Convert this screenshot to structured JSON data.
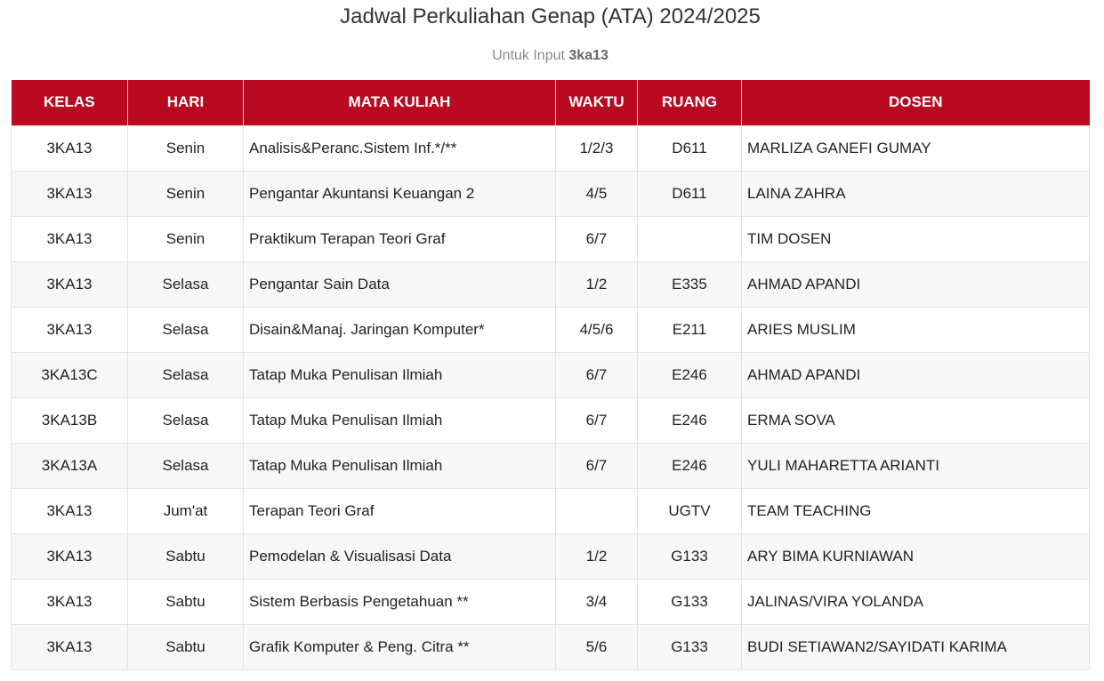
{
  "header": {
    "title": "Jadwal Perkuliahan Genap (ATA) 2024/2025",
    "subtitle_prefix": "Untuk Input",
    "subtitle_value": "3ka13"
  },
  "colors": {
    "header_bg": "#b90a22",
    "header_text": "#ffffff",
    "stripe": "#f7f7f7"
  },
  "table": {
    "columns": [
      "KELAS",
      "HARI",
      "MATA KULIAH",
      "WAKTU",
      "RUANG",
      "DOSEN"
    ],
    "rows": [
      {
        "kelas": "3KA13",
        "hari": "Senin",
        "mata_kuliah": "Analisis&Peranc.Sistem Inf.*/**",
        "waktu": "1/2/3",
        "ruang": "D611",
        "dosen": "MARLIZA GANEFI GUMAY"
      },
      {
        "kelas": "3KA13",
        "hari": "Senin",
        "mata_kuliah": "Pengantar Akuntansi Keuangan 2",
        "waktu": "4/5",
        "ruang": "D611",
        "dosen": "LAINA ZAHRA"
      },
      {
        "kelas": "3KA13",
        "hari": "Senin",
        "mata_kuliah": "Praktikum Terapan Teori Graf",
        "waktu": "6/7",
        "ruang": "",
        "dosen": "TIM DOSEN"
      },
      {
        "kelas": "3KA13",
        "hari": "Selasa",
        "mata_kuliah": "Pengantar Sain Data",
        "waktu": "1/2",
        "ruang": "E335",
        "dosen": "AHMAD APANDI"
      },
      {
        "kelas": "3KA13",
        "hari": "Selasa",
        "mata_kuliah": "Disain&Manaj. Jaringan Komputer*",
        "waktu": "4/5/6",
        "ruang": "E211",
        "dosen": "ARIES MUSLIM"
      },
      {
        "kelas": "3KA13C",
        "hari": "Selasa",
        "mata_kuliah": "Tatap Muka Penulisan Ilmiah",
        "waktu": "6/7",
        "ruang": "E246",
        "dosen": "AHMAD APANDI"
      },
      {
        "kelas": "3KA13B",
        "hari": "Selasa",
        "mata_kuliah": "Tatap Muka Penulisan Ilmiah",
        "waktu": "6/7",
        "ruang": "E246",
        "dosen": "ERMA SOVA"
      },
      {
        "kelas": "3KA13A",
        "hari": "Selasa",
        "mata_kuliah": "Tatap Muka Penulisan Ilmiah",
        "waktu": "6/7",
        "ruang": "E246",
        "dosen": "YULI MAHARETTA ARIANTI"
      },
      {
        "kelas": "3KA13",
        "hari": "Jum'at",
        "mata_kuliah": "Terapan Teori Graf",
        "waktu": "",
        "ruang": "UGTV",
        "dosen": "TEAM TEACHING"
      },
      {
        "kelas": "3KA13",
        "hari": "Sabtu",
        "mata_kuliah": "Pemodelan & Visualisasi Data",
        "waktu": "1/2",
        "ruang": "G133",
        "dosen": "ARY BIMA KURNIAWAN"
      },
      {
        "kelas": "3KA13",
        "hari": "Sabtu",
        "mata_kuliah": "Sistem Berbasis Pengetahuan **",
        "waktu": "3/4",
        "ruang": "G133",
        "dosen": "JALINAS/VIRA YOLANDA"
      },
      {
        "kelas": "3KA13",
        "hari": "Sabtu",
        "mata_kuliah": "Grafik Komputer & Peng. Citra **",
        "waktu": "5/6",
        "ruang": "G133",
        "dosen": "BUDI SETIAWAN2/SAYIDATI KARIMA"
      }
    ]
  }
}
